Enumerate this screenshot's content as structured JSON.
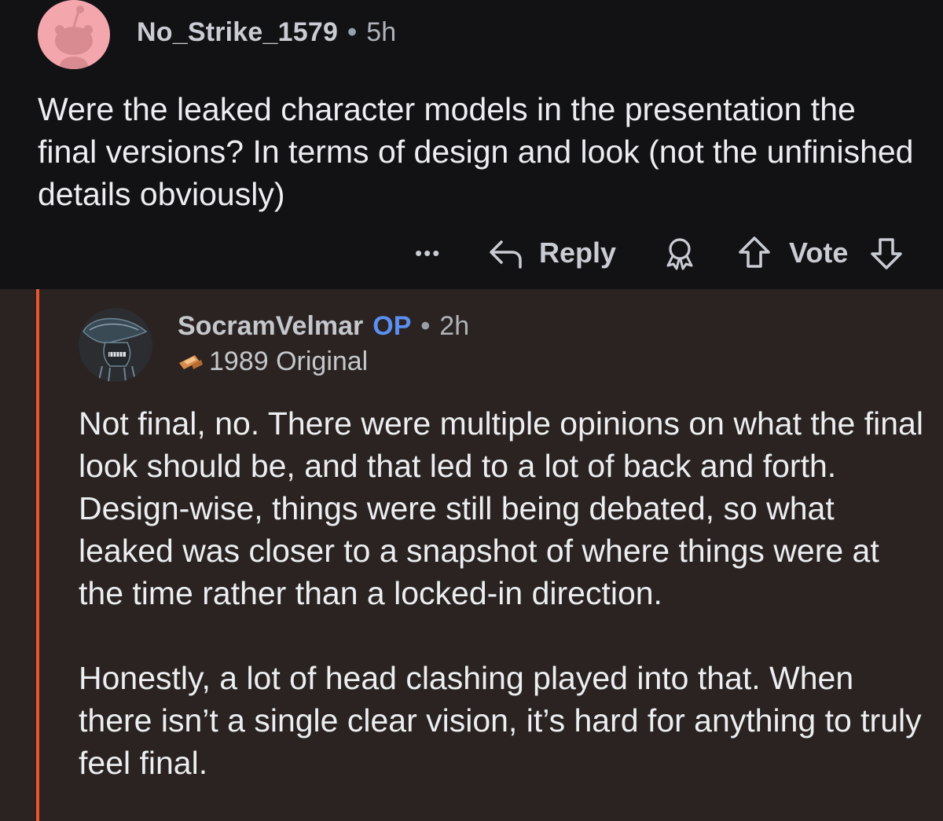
{
  "parent_comment": {
    "username": "No_Strike_1579",
    "separator": "•",
    "age": "5h",
    "body": "Were the leaked character models in the presentation the final versions? In terms of design and look (not the unfinished details obviously)",
    "actions": {
      "more_label": "•••",
      "reply_label": "Reply",
      "vote_label": "Vote"
    },
    "avatar_color": "#f4a6ad"
  },
  "reply_comment": {
    "username": "SocramVelmar",
    "op_badge": "OP",
    "separator": "•",
    "age": "2h",
    "flair": "1989 Original",
    "paragraphs": [
      "Not final, no. There were multiple opinions on what the final look should be, and that led to a lot of back and forth. Design-wise, things were still being debated, so what leaked was closer to a snapshot of where things were at the time rather than a locked-in direction.",
      "Honestly, a lot of head clashing played into that. When there isn’t a single clear vision, it’s hard for anything to truly feel final."
    ],
    "thread_line_color": "#e9552e",
    "op_color": "#5b8ff0"
  }
}
